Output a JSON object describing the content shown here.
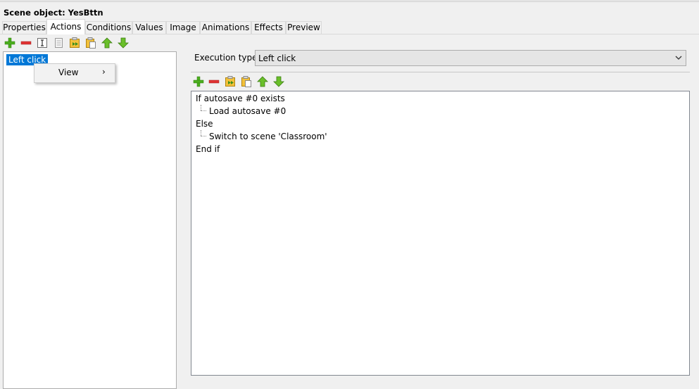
{
  "window": {
    "title": "Scene object: YesBttn"
  },
  "tabs": [
    {
      "label": "Properties"
    },
    {
      "label": "Actions"
    },
    {
      "label": "Conditions"
    },
    {
      "label": "Values"
    },
    {
      "label": "Image"
    },
    {
      "label": "Animations"
    },
    {
      "label": "Effects"
    },
    {
      "label": "Preview"
    }
  ],
  "active_tab": "Actions",
  "left_toolbar": [
    "add-icon",
    "remove-icon",
    "rename-icon",
    "copy-icon",
    "duplicate-icon",
    "paste-icon",
    "move-up-icon",
    "move-down-icon"
  ],
  "right_toolbar": [
    "add-icon",
    "remove-icon",
    "duplicate-icon",
    "paste-icon",
    "move-up-icon",
    "move-down-icon"
  ],
  "event_list": {
    "items": [
      {
        "label": "Left click",
        "selected": true
      }
    ]
  },
  "context_menu": {
    "items": [
      {
        "label": "View",
        "has_submenu": true
      }
    ]
  },
  "execution": {
    "label": "Execution type",
    "value": "Left click"
  },
  "actions": [
    {
      "text": "If autosave #0 exists",
      "indent": 0
    },
    {
      "text": "Load autosave #0",
      "indent": 1
    },
    {
      "text": "Else",
      "indent": 0
    },
    {
      "text": "Switch to scene 'Classroom'",
      "indent": 1
    },
    {
      "text": "End if",
      "indent": 0
    }
  ],
  "colors": {
    "accent": "#0078d7",
    "icon_green": "#4caf1e",
    "icon_red": "#e03232"
  }
}
